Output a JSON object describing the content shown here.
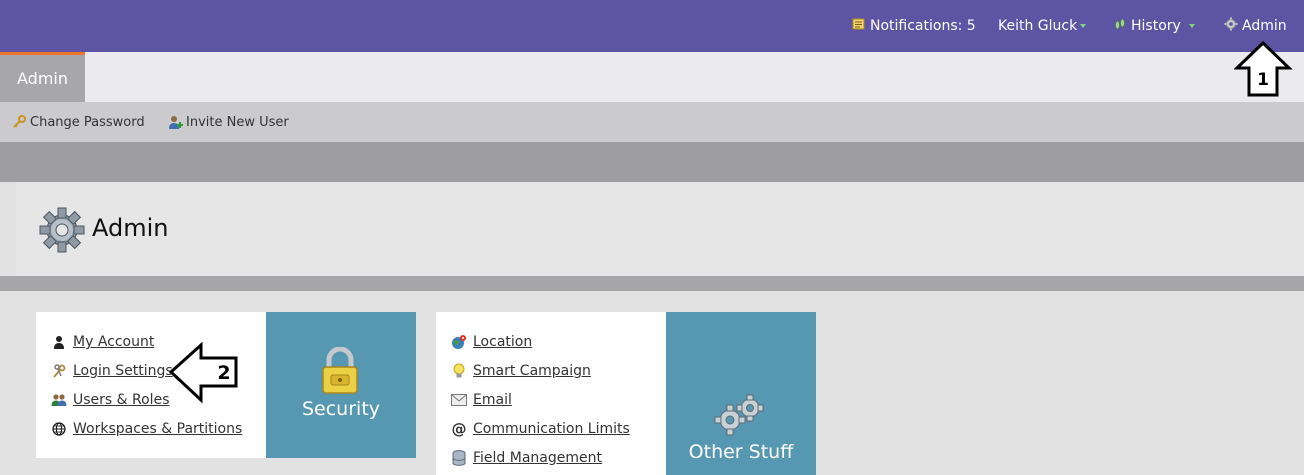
{
  "topnav": {
    "notifications_label": "Notifications: 5",
    "user_label": "Keith Gluck",
    "history_label": "History",
    "admin_label": "Admin"
  },
  "tabs": [
    {
      "label": "Admin"
    }
  ],
  "subnav": {
    "change_password": "Change Password",
    "invite_user": "Invite New User"
  },
  "page": {
    "title": "Admin"
  },
  "security_card": {
    "links": [
      {
        "label": "My Account",
        "icon": "user-icon"
      },
      {
        "label": "Login Settings",
        "icon": "keys-icon"
      },
      {
        "label": "Users & Roles",
        "icon": "users-icon"
      },
      {
        "label": "Workspaces & Partitions",
        "icon": "globe-icon"
      }
    ],
    "tile_label": "Security"
  },
  "other_card": {
    "links": [
      {
        "label": "Location",
        "icon": "location-globe-icon"
      },
      {
        "label": "Smart Campaign",
        "icon": "lightbulb-icon"
      },
      {
        "label": "Email",
        "icon": "email-icon"
      },
      {
        "label": "Communication Limits",
        "icon": "at-icon"
      },
      {
        "label": "Field Management",
        "icon": "database-icon"
      }
    ],
    "tile_label": "Other Stuff"
  },
  "annotations": {
    "arrow_1": "1",
    "arrow_2": "2"
  },
  "colors": {
    "topbar": "#5e54a4",
    "tile": "#5697b2",
    "tab_accent": "#f2732c"
  }
}
